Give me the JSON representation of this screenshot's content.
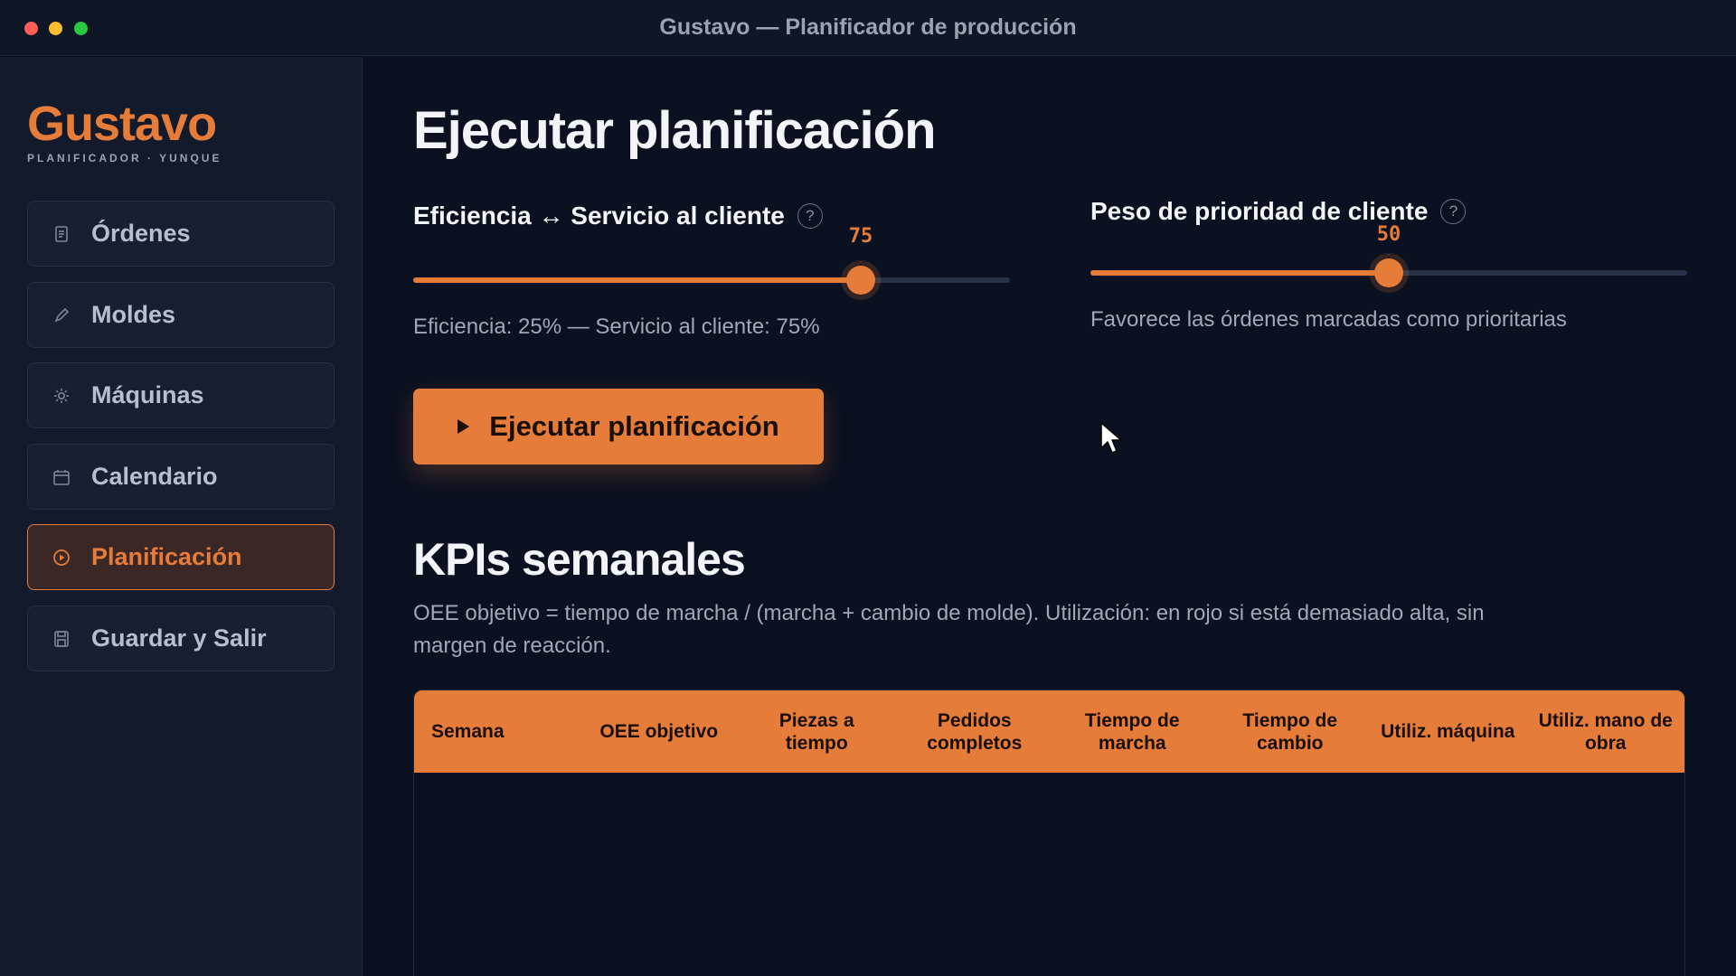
{
  "window": {
    "title": "Gustavo — Planificador de producción"
  },
  "sidebar": {
    "brand": "Gustavo",
    "brand_sub": "PLANIFICADOR · YUNQUE",
    "items": [
      {
        "label": "Órdenes",
        "icon": "document-icon"
      },
      {
        "label": "Moldes",
        "icon": "pencil-icon"
      },
      {
        "label": "Máquinas",
        "icon": "gear-icon"
      },
      {
        "label": "Calendario",
        "icon": "calendar-icon"
      },
      {
        "label": "Planificación",
        "icon": "play-circle-icon",
        "active": true
      },
      {
        "label": "Guardar y Salir",
        "icon": "save-icon"
      }
    ]
  },
  "main": {
    "title": "Ejecutar planificación",
    "slider_efficiency": {
      "label": "Eficiencia ↔ Servicio al cliente",
      "help": "?",
      "value": 75,
      "value_text": "75",
      "caption": "Eficiencia: 25% — Servicio al cliente: 75%"
    },
    "slider_priority": {
      "label": "Peso de prioridad de cliente",
      "help": "?",
      "value": 50,
      "value_text": "50",
      "caption": "Favorece las órdenes marcadas como prioritarias"
    },
    "run_button": "Ejecutar planificación",
    "kpi": {
      "title": "KPIs semanales",
      "description": "OEE objetivo = tiempo de marcha / (marcha + cambio de molde). Utilización: en rojo si está demasiado alta, sin margen de reacción.",
      "columns": [
        "Semana",
        "OEE objetivo",
        "Piezas a tiempo",
        "Pedidos completos",
        "Tiempo de marcha",
        "Tiempo de cambio",
        "Utiliz. máquina",
        "Utiliz. mano de obra"
      ],
      "rows": []
    }
  },
  "colors": {
    "accent": "#e67c3a",
    "background": "#0b1120",
    "sidebar": "#121a2b"
  }
}
